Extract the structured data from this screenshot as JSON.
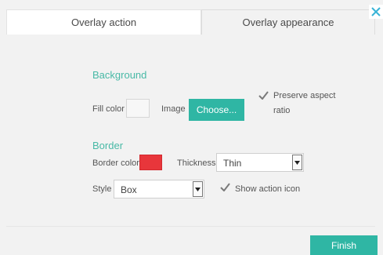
{
  "tabs": [
    {
      "label": "Overlay action"
    },
    {
      "label": "Overlay appearance"
    }
  ],
  "background_section": {
    "heading": "Background",
    "fill_color_label": "Fill color",
    "fill_color_value": "#f7f7f7",
    "image_label": "Image",
    "choose_button_label": "Choose...",
    "preserve_aspect_label_line1": "Preserve aspect",
    "preserve_aspect_label_line2": "ratio",
    "preserve_aspect_checked": true
  },
  "border_section": {
    "heading": "Border",
    "border_color_label": "Border color",
    "border_color_value": "#e8363b",
    "thickness_label": "Thickness",
    "thickness_value": "Thin",
    "style_label": "Style",
    "style_value": "Box",
    "show_action_icon_label": "Show action icon",
    "show_action_icon_checked": true
  },
  "footer": {
    "finish_button_label": "Finish"
  },
  "colors": {
    "accent": "#2fb6a4",
    "heading": "#48b9a6"
  },
  "icons": {
    "close": "close-icon",
    "check": "checkmark-icon",
    "dropdown": "dropdown-arrow-icon"
  }
}
